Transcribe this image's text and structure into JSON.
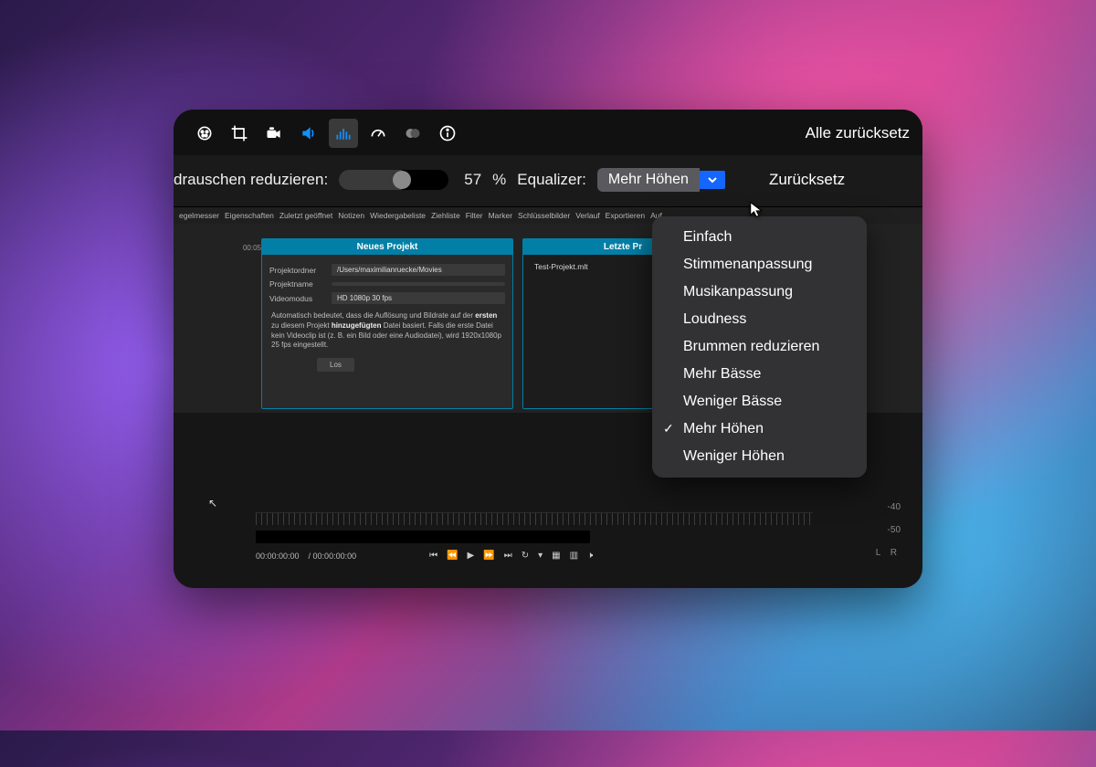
{
  "toolbar": {
    "reset_all": "Alle zurücksetz"
  },
  "controls": {
    "noise_label": "drauschen reduzieren:",
    "noise_value": "57",
    "noise_unit": "%",
    "eq_label": "Equalizer:",
    "eq_value": "Mehr Höhen",
    "reset": "Zurücksetz"
  },
  "tabs": [
    "egelmesser",
    "Eigenschaften",
    "Zuletzt geöffnet",
    "Notizen",
    "Wiedergabeliste",
    "Ziehliste",
    "Filter",
    "Marker",
    "Schlüsselbilder",
    "Verlauf",
    "Exportieren",
    "Auf"
  ],
  "new_project": {
    "title": "Neues Projekt",
    "rows": {
      "folder_label": "Projektordner",
      "folder_value": "/Users/maximilianruecke/Movies",
      "name_label": "Projektname",
      "name_value": "",
      "mode_label": "Videomodus",
      "mode_value": "HD 1080p 30 fps"
    },
    "desc_prefix": "Automatisch bedeutet, dass die Auflösung und Bildrate auf der ",
    "desc_bold1": "ersten",
    "desc_mid": " zu diesem Projekt ",
    "desc_bold2": "hinzugefügten",
    "desc_suffix": " Datei basiert. Falls die erste Datei kein Videoclip ist (z. B. ein Bild oder eine Audiodatei), wird 1920x1080p 25 fps eingestellt.",
    "start_btn": "Los"
  },
  "recent": {
    "title": "Letzte Pr",
    "file": "Test-Projekt.mlt"
  },
  "dropdown": {
    "items": [
      "Einfach",
      "Stimmenanpassung",
      "Musikanpassung",
      "Loudness",
      "Brummen reduzieren",
      "Mehr Bässe",
      "Weniger Bässe",
      "Mehr Höhen",
      "Weniger Höhen"
    ],
    "checked": "Mehr Höhen"
  },
  "transport": {
    "tc_current": "00:00:00:00",
    "tc_total": "/ 00:00:00:00"
  },
  "db": {
    "a": "-40",
    "b": "-50",
    "lr": "L R"
  },
  "level_col": "00:05"
}
